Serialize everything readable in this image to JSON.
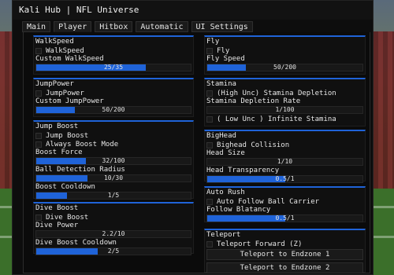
{
  "window": {
    "title": "Kali Hub | NFL Universe"
  },
  "tabs": [
    {
      "label": "Main"
    },
    {
      "label": "Player"
    },
    {
      "label": "Hitbox"
    },
    {
      "label": "Automatic"
    },
    {
      "label": "UI Settings"
    }
  ],
  "active_tab": "Player",
  "left": {
    "walkspeed": {
      "title": "WalkSpeed",
      "toggle": "WalkSpeed",
      "slider_label": "Custom WalkSpeed",
      "slider_value": "25/35",
      "slider_fraction": 0.71
    },
    "jumppower": {
      "title": "JumpPower",
      "toggle": "JumpPower",
      "slider_label": "Custom JumpPower",
      "slider_value": "50/200",
      "slider_fraction": 0.25
    },
    "jumpboost": {
      "title": "Jump Boost",
      "toggle1": "Jump Boost",
      "toggle2": "Always Boost Mode",
      "force_label": "Boost Force",
      "force_value": "32/100",
      "force_fraction": 0.32,
      "radius_label": "Ball Detection Radius",
      "radius_value": "10/30",
      "radius_fraction": 0.33,
      "cooldown_label": "Boost Cooldown",
      "cooldown_value": "1/5",
      "cooldown_fraction": 0.2
    },
    "diveboost": {
      "title": "Dive Boost",
      "toggle": "Dive Boost",
      "power_label": "Dive Power",
      "power_value": "2.2/10",
      "power_fraction": 0.0,
      "cooldown_label": "Dive Boost Cooldown",
      "cooldown_value": "2/5",
      "cooldown_fraction": 0.4
    }
  },
  "right": {
    "fly": {
      "title": "Fly",
      "toggle": "Fly",
      "slider_label": "Fly Speed",
      "slider_value": "50/200",
      "slider_fraction": 0.25
    },
    "stamina": {
      "title": "Stamina",
      "toggle1": "(High Unc) Stamina Depletion",
      "rate_label": "Stamina Depletion Rate",
      "rate_value": "1/100",
      "rate_fraction": 0.0,
      "toggle2": "( Low Unc ) Infinite Stamina"
    },
    "bighead": {
      "title": "BigHead",
      "toggle": "Bighead Collision",
      "size_label": "Head Size",
      "size_value": "1/10",
      "size_fraction": 0.0,
      "transparency_label": "Head Transparency",
      "transparency_value": "0.5/1",
      "transparency_fraction": 0.5
    },
    "autorush": {
      "title": "Auto Rush",
      "toggle": "Auto Follow Ball Carrier",
      "slider_label": "Follow Blatancy",
      "slider_value": "0.5/1",
      "slider_fraction": 0.5
    },
    "teleport": {
      "title": "Teleport",
      "toggle": "Teleport Forward (Z)",
      "button1": "Teleport to Endzone 1",
      "button2": "Teleport to Endzone 2"
    }
  },
  "colors": {
    "accent": "#1f63d8",
    "panel": "#101010",
    "window": "#0d0d0d"
  }
}
